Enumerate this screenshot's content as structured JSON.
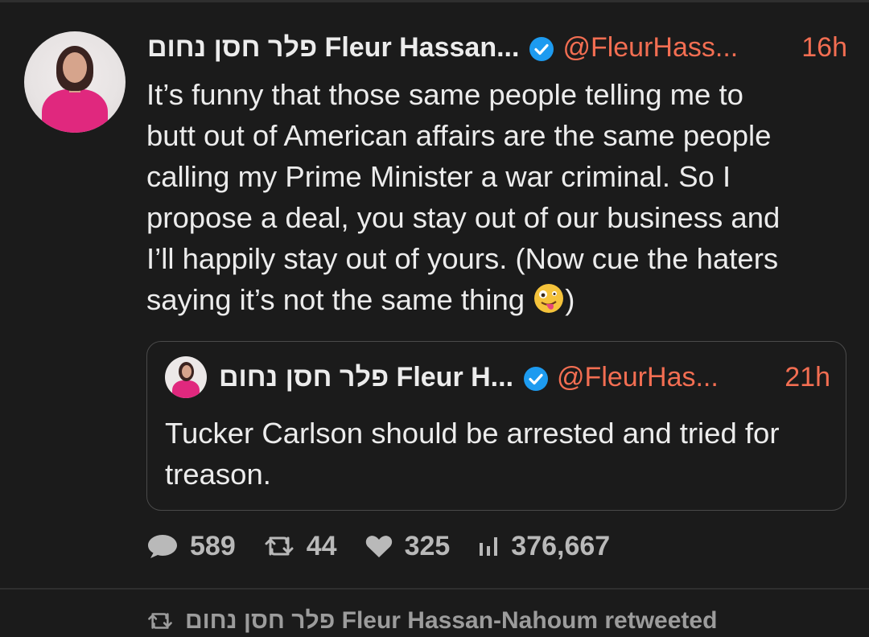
{
  "tweet": {
    "author_name": "פלר חסן נחום Fleur Hassan...",
    "handle": "@FleurHass...",
    "time": "16h",
    "lines": [
      "It’s funny that those same people telling me to",
      "butt out of American affairs are the same people",
      "calling my Prime Minister a war criminal.  So I",
      "propose a deal, you stay out of our business and",
      "I’ll happily stay out  of yours. (Now cue the haters",
      "saying it’s not the same thing "
    ],
    "closing": ")",
    "emoji_icon": "zany-face-emoji"
  },
  "quote": {
    "author_name": "פלר חסן נחום Fleur H...",
    "handle": "@FleurHas...",
    "time": "21h",
    "lines": [
      "Tucker Carlson should be arrested and tried for",
      "treason."
    ]
  },
  "actions": {
    "replies": "589",
    "retweets": "44",
    "likes": "325",
    "views": "376,667"
  },
  "next": {
    "retweet_label": "פלר חסן נחום Fleur Hassan-Nahoum retweeted"
  },
  "colors": {
    "background": "#1b1b1b",
    "accent": "#f36e52",
    "verified": "#1d9bf0",
    "text": "#ececec",
    "muted": "#b9b9b9"
  }
}
